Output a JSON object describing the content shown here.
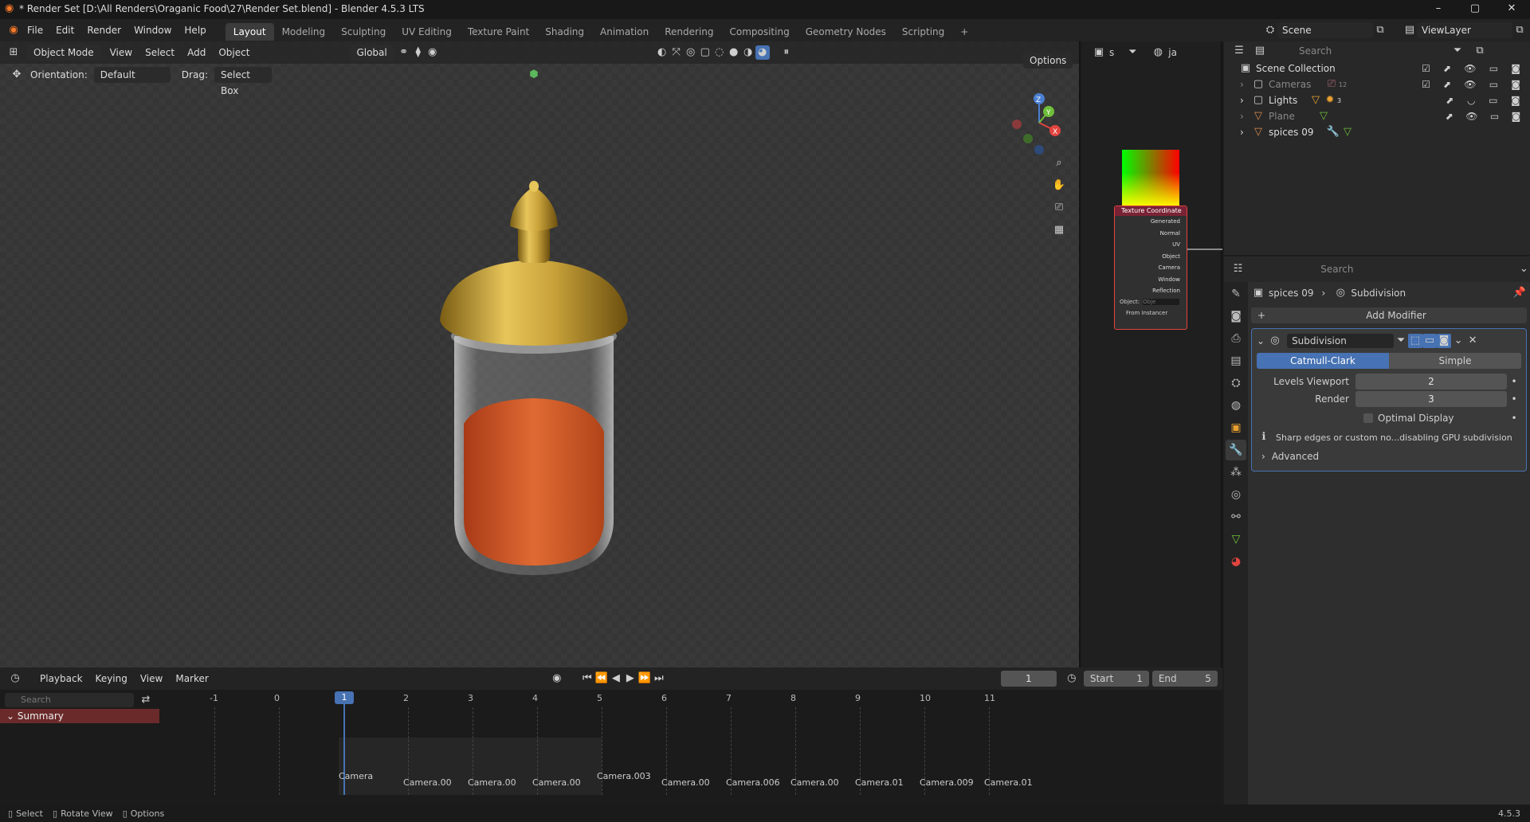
{
  "titlebar": {
    "title": "* Render Set [D:\\All Renders\\Oraganic Food\\27\\Render Set.blend] - Blender 4.5.3 LTS",
    "min": "–",
    "max": "▢",
    "close": "✕"
  },
  "menu": {
    "items": [
      "File",
      "Edit",
      "Render",
      "Window",
      "Help"
    ]
  },
  "workspaces": [
    "Layout",
    "Modeling",
    "Sculpting",
    "UV Editing",
    "Texture Paint",
    "Shading",
    "Animation",
    "Rendering",
    "Compositing",
    "Geometry Nodes",
    "Scripting",
    "+"
  ],
  "scene": {
    "name": "Scene",
    "viewlayer": "ViewLayer"
  },
  "viewport": {
    "mode": "Object Mode",
    "menus": [
      "View",
      "Select",
      "Add",
      "Object"
    ],
    "transform_space": "Global",
    "orientation_label": "Orientation:",
    "orientation_value": "Default",
    "drag_label": "Drag:",
    "drag_value": "Select Box",
    "options": "Options",
    "object_menu": "Object",
    "view_menu": "View"
  },
  "node": {
    "title": "Texture Coordinate",
    "outputs": [
      "Generated",
      "Normal",
      "UV",
      "Object",
      "Camera",
      "Window",
      "Reflection"
    ],
    "object_label": "Object:",
    "object_placeholder": "Obje",
    "instancer": "From Instancer",
    "search1": "s",
    "search2": "ja"
  },
  "outliner": {
    "search_placeholder": "Search",
    "root": "Scene Collection",
    "items": [
      {
        "name": "Cameras",
        "badge": "12"
      },
      {
        "name": "Lights",
        "badge": "3"
      },
      {
        "name": "Plane",
        "badge": ""
      },
      {
        "name": "spices 09",
        "badge": ""
      }
    ]
  },
  "properties": {
    "search_placeholder": "Search",
    "breadcrumb_object": "spices 09",
    "breadcrumb_modifier": "Subdivision",
    "add_modifier": "Add Modifier",
    "modifier_name": "Subdivision",
    "method_a": "Catmull-Clark",
    "method_b": "Simple",
    "levels_viewport_label": "Levels Viewport",
    "levels_viewport": "2",
    "render_label": "Render",
    "render_value": "3",
    "optimal_display": "Optimal Display",
    "warning": "Sharp edges or custom no...disabling GPU subdivision",
    "advanced": "Advanced"
  },
  "timeline": {
    "menus": [
      "Playback",
      "Keying",
      "View",
      "Marker"
    ],
    "current_frame": "1",
    "start_label": "Start",
    "start": "1",
    "end_label": "End",
    "end": "5",
    "search_placeholder": "Search",
    "summary": "Summary",
    "ticks": [
      "-1",
      "0",
      "1",
      "2",
      "3",
      "4",
      "5",
      "6",
      "7",
      "8",
      "9",
      "10",
      "11"
    ],
    "markers": [
      "Camera",
      "Camera.00",
      "Camera.00",
      "Camera.00",
      "Camera.003",
      "Camera.00",
      "Camera.006",
      "Camera.00",
      "Camera.01",
      "Camera.009",
      "Camera.01"
    ]
  },
  "status": {
    "select": "Select",
    "rotate": "Rotate View",
    "options": "Options",
    "version": "4.5.3"
  }
}
